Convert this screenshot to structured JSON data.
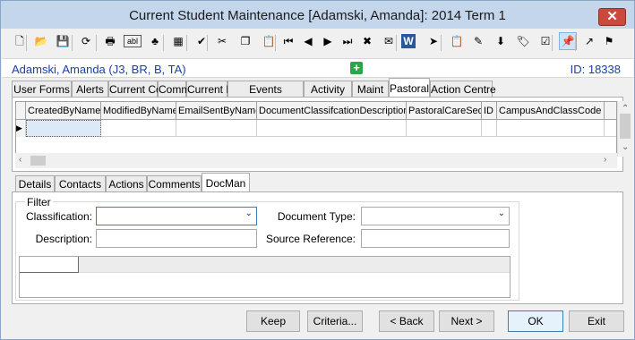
{
  "window": {
    "title": "Current Student Maintenance  [Adamski, Amanda]:  2014 Term 1",
    "close_label": "✕"
  },
  "toolbar": {
    "icons": [
      {
        "name": "new-document-icon",
        "glyph": "🗋"
      },
      {
        "name": "open-folder-icon",
        "glyph": "📂"
      },
      {
        "name": "save-icon",
        "glyph": "💾"
      },
      {
        "name": "refresh-icon",
        "glyph": "⟳"
      },
      {
        "name": "print-icon",
        "glyph": "🖶"
      },
      {
        "name": "text-field-icon",
        "glyph": "abl"
      },
      {
        "name": "tree-icon",
        "glyph": "♣"
      },
      {
        "name": "calculator-icon",
        "glyph": "▦"
      },
      {
        "name": "spellcheck-icon",
        "glyph": "✔"
      },
      {
        "name": "cut-icon",
        "glyph": "✂"
      },
      {
        "name": "copy-icon",
        "glyph": "❐"
      },
      {
        "name": "paste-icon",
        "glyph": "📋"
      },
      {
        "name": "first-record-icon",
        "glyph": "⏮"
      },
      {
        "name": "previous-record-icon",
        "glyph": "◀"
      },
      {
        "name": "next-record-icon",
        "glyph": "▶"
      },
      {
        "name": "last-record-icon",
        "glyph": "⏭"
      },
      {
        "name": "delete-icon",
        "glyph": "✖"
      },
      {
        "name": "email-icon",
        "glyph": "✉"
      },
      {
        "name": "word-document-icon",
        "glyph": "W"
      },
      {
        "name": "send-icon",
        "glyph": "➤"
      },
      {
        "name": "clipboard-icon",
        "glyph": "📋"
      },
      {
        "name": "report-stamp-icon",
        "glyph": "✎"
      },
      {
        "name": "download-icon",
        "glyph": "⬇"
      },
      {
        "name": "tag-icon",
        "glyph": "🏷"
      },
      {
        "name": "checklist-icon",
        "glyph": "☑"
      },
      {
        "name": "pin-icon",
        "glyph": "📌"
      },
      {
        "name": "arrow-link-icon",
        "glyph": "↗"
      },
      {
        "name": "flag-icon",
        "glyph": "⚑"
      }
    ]
  },
  "student": {
    "name_line": "Adamski, Amanda (J3, BR, B, TA)",
    "id_text": "ID: 18338",
    "add_glyph": "+"
  },
  "main_tabs": [
    "User Forms",
    "Alerts",
    "Current Comms",
    "Comms",
    "Current Events",
    "Events",
    "Activity",
    "Maint",
    "Pastoral Care",
    "Action Centre"
  ],
  "main_tab_selected": "Pastoral Care",
  "grid": {
    "columns": [
      "CreatedByName",
      "ModifiedByName",
      "EmailSentByName",
      "DocumentClassifcationDescription",
      "PastoralCareSeq",
      "ID",
      "CampusAndClassCode"
    ],
    "row_indicator": "▶"
  },
  "sub_tabs": [
    "Details",
    "Contacts",
    "Actions",
    "Comments",
    "DocMan"
  ],
  "sub_tab_selected": "DocMan",
  "filter": {
    "legend": "Filter",
    "classification_label": "Classification:",
    "classification_value": "",
    "document_type_label": "Document Type:",
    "document_type_value": "",
    "description_label": "Description:",
    "description_value": "",
    "source_reference_label": "Source Reference:",
    "source_reference_value": ""
  },
  "buttons": {
    "keep": "Keep",
    "criteria": "Criteria...",
    "back": "< Back",
    "next": "Next >",
    "ok": "OK",
    "exit": "Exit"
  },
  "colors": {
    "title_bar": "#c4d6ec",
    "student_text": "#1a3ea8",
    "close_button": "#c94a3c",
    "add_icon": "#2ba54a"
  }
}
